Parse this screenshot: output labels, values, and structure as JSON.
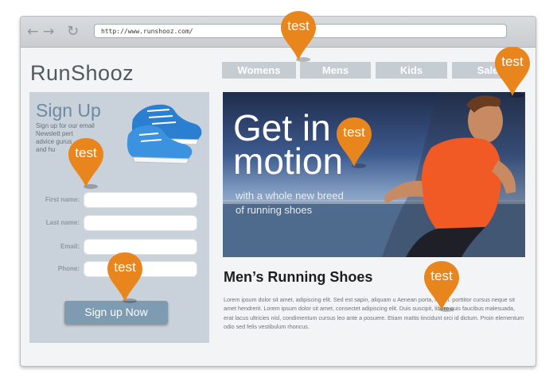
{
  "browser": {
    "url": "http://www.runshooz.com/"
  },
  "site": {
    "logo": "RunShooz",
    "nav_tabs": [
      "Womens",
      "Mens",
      "Kids",
      "Sale"
    ]
  },
  "signup": {
    "title": "Sign Up",
    "description_lines": [
      "Sign up for our email",
      "Newslett        pert",
      "advice              gurus",
      "and hu"
    ],
    "fields": [
      {
        "label": "First name:",
        "value": ""
      },
      {
        "label": "Last name:",
        "value": ""
      },
      {
        "label": "Email:",
        "value": ""
      },
      {
        "label": "Phone:",
        "value": ""
      }
    ],
    "button_label": "Sign up Now"
  },
  "hero": {
    "title_line1": "Get in",
    "title_line2": "motion",
    "subtitle_line1": "with a whole new breed",
    "subtitle_line2": "of running shoes"
  },
  "content": {
    "title": "Men’s Running Shoes",
    "body": "Lorem ipsum dolor sit amet, adipiscing elit. Sed est sapin, aliquam u   Aenean porta, lorem. porttitor cursus neque sit amet hendrerit. Lorem ipsum dolor sit amet, consectet   adipiscing elit. Duis suscipit, libero quis faucibus malesuada, erat lacus ultricies nisl, condimentum cursus leo ante a posuere. Etiam mattis tincidunt orci id dictum. Proin elementum odio sed felis vestibulum rhoncus."
  },
  "pins": {
    "label": "test",
    "color": "#e8861d",
    "count": 6
  },
  "colors": {
    "accent_orange": "#e8861d",
    "tab_gray": "#c5ccd2",
    "panel": "#c9d2da",
    "signup_button": "#7f9bb1",
    "heading_blue": "#6d8aa1"
  }
}
